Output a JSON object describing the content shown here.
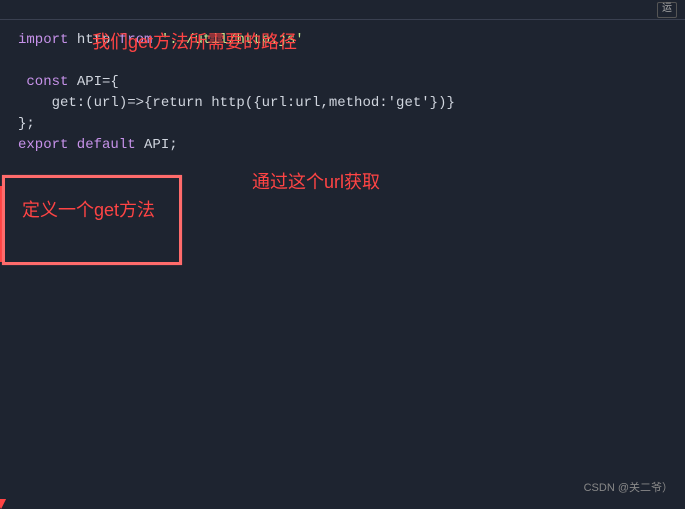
{
  "code": {
    "line1_pre": "import",
    "line1_ident": " http ",
    "line1_from": "from",
    "line1_str": " '../util/http.js'",
    "line3_pre": " const",
    "line3_rest": " API={",
    "line4": "    get:(url)=>{return http({url:url,method:'get'})}",
    "line5": "};",
    "line6_pre": "export default",
    "line6_rest": " API;"
  },
  "annotations": {
    "top": "我们get方法所需要的路径",
    "right": "通过这个url获取",
    "box": "定义一个get方法"
  },
  "watermark": "CSDN @关二爷）",
  "top_button": "运"
}
